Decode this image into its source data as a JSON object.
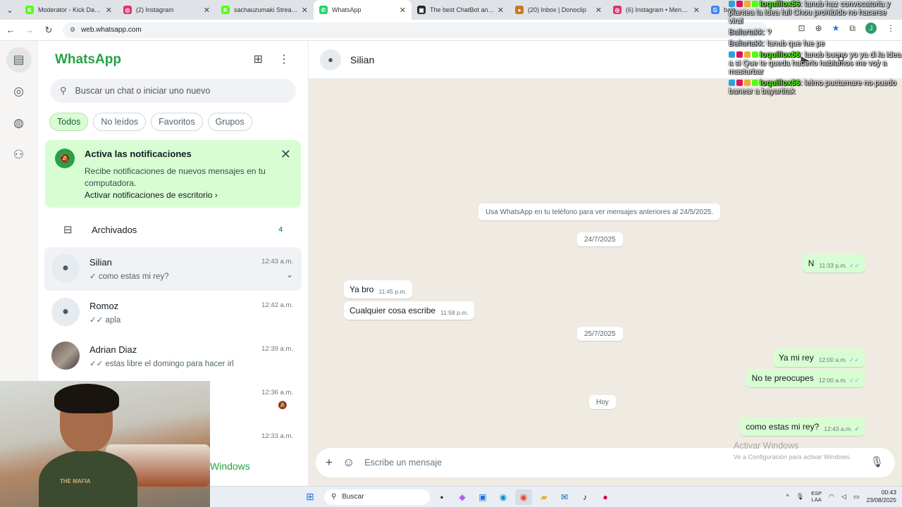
{
  "browser": {
    "tabs": [
      {
        "title": "Moderator - Kick Dashbo...",
        "favicon": "kick-icon",
        "color": "#53fc18",
        "glyph": "K",
        "active": false
      },
      {
        "title": "(2) Instagram",
        "favicon": "instagram-icon",
        "color": "#e1306c",
        "glyph": "◎",
        "active": false
      },
      {
        "title": "sachauzumaki Stream - W...",
        "favicon": "kick-icon",
        "color": "#53fc18",
        "glyph": "K",
        "active": false
      },
      {
        "title": "WhatsApp",
        "favicon": "whatsapp-icon",
        "color": "#25d366",
        "glyph": "✆",
        "active": true
      },
      {
        "title": "The best ChatBot and Wi...",
        "favicon": "chatbot-icon",
        "color": "#222222",
        "glyph": "▣",
        "active": false
      },
      {
        "title": "(20) Inbox | Donoclip",
        "favicon": "donoclip-icon",
        "color": "#c57a1e",
        "glyph": "●",
        "active": false
      },
      {
        "title": "(6) Instagram • Mensajes",
        "favicon": "instagram-icon",
        "color": "#e1306c",
        "glyph": "◎",
        "active": false
      },
      {
        "title": "bale...",
        "favicon": "google-icon",
        "color": "#4285f4",
        "glyph": "G",
        "active": false
      }
    ],
    "url": "web.whatsapp.com",
    "profile_initial": "J"
  },
  "sidebar": {
    "title": "WhatsApp",
    "search_placeholder": "Buscar un chat o iniciar uno nuevo",
    "filters": [
      "Todos",
      "No leídos",
      "Favoritos",
      "Grupos"
    ],
    "notification": {
      "title": "Activa las notificaciones",
      "body": "Recibe notificaciones de nuevos mensajes en tu computadora.",
      "link": "Activar notificaciones de escritorio ›"
    },
    "archived": {
      "label": "Archivados",
      "count": "4"
    },
    "chats": [
      {
        "name": "Silian",
        "time": "12:43 a.m.",
        "preview": "✓ como estas mi rey?",
        "active": true,
        "photo": false
      },
      {
        "name": "Romoz",
        "time": "12:42 a.m.",
        "preview": "✓✓ apla",
        "active": false,
        "photo": false
      },
      {
        "name": "Adrian Diaz",
        "time": "12:39 a.m.",
        "preview": "✓✓ estas libre el domingo para hacer irl",
        "active": false,
        "photo": true
      },
      {
        "name": "",
        "time": "12:36 a.m.",
        "preview": "",
        "active": false,
        "photo": false,
        "muted": true
      },
      {
        "name": "",
        "time": "12:33 a.m.",
        "preview": "",
        "active": false,
        "photo": false
      }
    ],
    "footer_text": "Windows"
  },
  "conversation": {
    "contact_name": "Silian",
    "system_message": "Usa WhatsApp en tu teléfono para ver mensajes anteriores al 24/5/2025.",
    "date_chips": [
      "24/7/2025",
      "25/7/2025",
      "Hoy"
    ],
    "messages": [
      {
        "text": "N",
        "time": "11:33 p.m.",
        "direction": "out",
        "ticks": "✓✓",
        "read": true
      },
      {
        "text": "Ya bro",
        "time": "11:45 p.m.",
        "direction": "in"
      },
      {
        "text": "Cualquier cosa escribe",
        "time": "11:58 p.m.",
        "direction": "in"
      },
      {
        "text": "Ya mi rey",
        "time": "12:00 a.m.",
        "direction": "out",
        "ticks": "✓✓",
        "read": true
      },
      {
        "text": "No te preocupes",
        "time": "12:00 a.m.",
        "direction": "out",
        "ticks": "✓✓",
        "read": true
      },
      {
        "text": "como estas mi rey?",
        "time": "12:43 a.m.",
        "direction": "out",
        "ticks": "✓",
        "read": false
      }
    ],
    "composer_placeholder": "Escribe un mensaje"
  },
  "stream_chat_overlay": [
    {
      "user": "loquillox56",
      "message": ": lanub haz convocatoria y plantea la idea full Chou prohibido no hacerse viral",
      "badges": true
    },
    {
      "user": "Ballartakk",
      "message": ": ?",
      "badges": false
    },
    {
      "user": "Ballartakk",
      "message": ": lanub que fue pe",
      "badges": false
    },
    {
      "user": "loquillox56",
      "message": ": lanub bueno yo ya di la idea a si Que te queda hacerlo hablamos me voy a masturbar",
      "badges": true
    },
    {
      "user": "loquillox56",
      "message": ": lelmo puctamare no puedo banear a bayartitak",
      "badges": true
    }
  ],
  "windows_watermark": {
    "title": "Activar Windows",
    "subtitle": "Ve a Configuración para activar Windows."
  },
  "webcam": {
    "shirt_text": "THE MAFIA"
  },
  "taskbar": {
    "search_label": "Buscar",
    "language_line1": "ESP",
    "language_line2": "LAA",
    "time": "00:43",
    "date": "23/08/2025"
  }
}
